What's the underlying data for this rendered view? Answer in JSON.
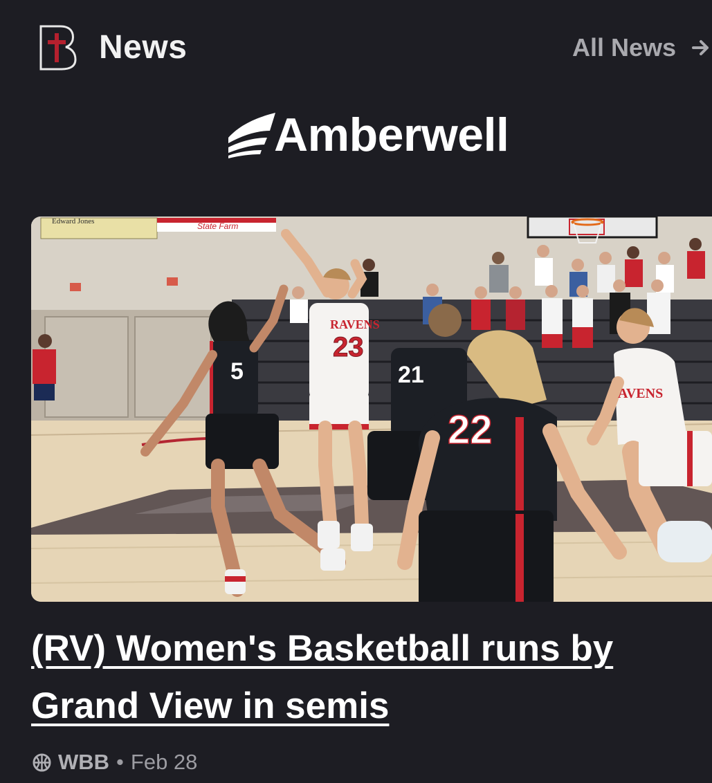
{
  "header": {
    "title": "News",
    "all_news_label": "All News",
    "logo_icon": "school-crest-icon",
    "arrow_icon": "arrow-right-icon"
  },
  "sponsor": {
    "name": "Amberwell",
    "icon": "amberwell-logo-icon"
  },
  "photo": {
    "banners": [
      "Edward Jones",
      "State Farm"
    ],
    "jersey_numbers": [
      "5",
      "23",
      "21",
      "22"
    ],
    "jersey_text": [
      "RAVENS",
      "AVENS"
    ]
  },
  "article": {
    "headline": "(RV) Women's Basketball runs by Grand View in semis",
    "sport": "WBB",
    "separator": "•",
    "date": "Feb 28",
    "sport_icon": "basketball-icon"
  },
  "colors": {
    "background": "#1d1d23",
    "muted_text": "#a9a9ae",
    "brand_red": "#b5202e"
  }
}
